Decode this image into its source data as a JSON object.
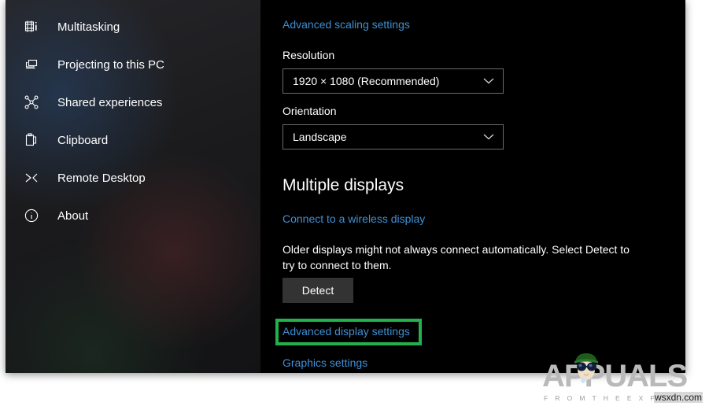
{
  "sidebar": {
    "items": [
      {
        "label": "Multitasking",
        "icon": "multitasking-icon"
      },
      {
        "label": "Projecting to this PC",
        "icon": "projecting-icon"
      },
      {
        "label": "Shared experiences",
        "icon": "shared-experiences-icon"
      },
      {
        "label": "Clipboard",
        "icon": "clipboard-icon"
      },
      {
        "label": "Remote Desktop",
        "icon": "remote-desktop-icon"
      },
      {
        "label": "About",
        "icon": "info-icon"
      }
    ]
  },
  "content": {
    "advanced_scaling_link": "Advanced scaling settings",
    "resolution_label": "Resolution",
    "resolution_value": "1920 × 1080 (Recommended)",
    "orientation_label": "Orientation",
    "orientation_value": "Landscape",
    "multiple_displays_title": "Multiple displays",
    "wireless_display_link": "Connect to a wireless display",
    "older_displays_text": "Older displays might not always connect automatically. Select Detect to try to connect to them.",
    "detect_button": "Detect",
    "advanced_display_link": "Advanced display settings",
    "graphics_settings_link": "Graphics settings"
  },
  "annotation": {
    "highlight_color": "#22b14c",
    "highlight_target": "Advanced display settings"
  },
  "watermark": {
    "brand": "APPUALS",
    "tagline": "F R O M   T H E   E X P E R T S",
    "domain": "wsxdn.com"
  },
  "colors": {
    "link": "#3f8fd4",
    "background": "#000000",
    "sidebar": "#1c1c1e",
    "button": "#333333",
    "text": "#ffffff"
  }
}
